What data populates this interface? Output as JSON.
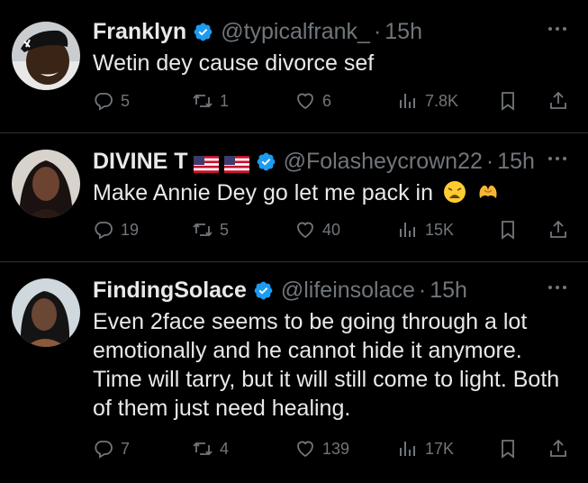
{
  "tweets": [
    {
      "name": "Franklyn",
      "handle": "@typicalfrank_",
      "separator": "·",
      "time": "15h",
      "text": "Wetin dey cause divorce sef",
      "replies": "5",
      "retweets": "1",
      "likes": "6",
      "views": "7.8K"
    },
    {
      "name": "DIVINE T",
      "handle": "@Folasheycrown22",
      "separator": "·",
      "time": "15h",
      "text": "Make Annie Dey go let me pack in",
      "replies": "19",
      "retweets": "5",
      "likes": "40",
      "views": "15K"
    },
    {
      "name": "FindingSolace",
      "handle": "@lifeinsolace",
      "separator": "·",
      "time": "15h",
      "text": "Even 2face seems to be going through a lot emotionally and he cannot hide it anymore. Time will tarry, but it will still come to light. Both of them just need healing.",
      "replies": "7",
      "retweets": "4",
      "likes": "139",
      "views": "17K"
    }
  ],
  "icons": {
    "verified": "verified-badge-icon",
    "more": "more-icon",
    "reply": "reply-icon",
    "retweet": "retweet-icon",
    "like": "heart-icon",
    "views": "views-icon",
    "bookmark": "bookmark-icon",
    "share": "share-icon"
  },
  "colors": {
    "background": "#000000",
    "text": "#e7e9ea",
    "muted": "#71767b",
    "verified": "#1d9bf0",
    "divider": "#2f3336"
  }
}
